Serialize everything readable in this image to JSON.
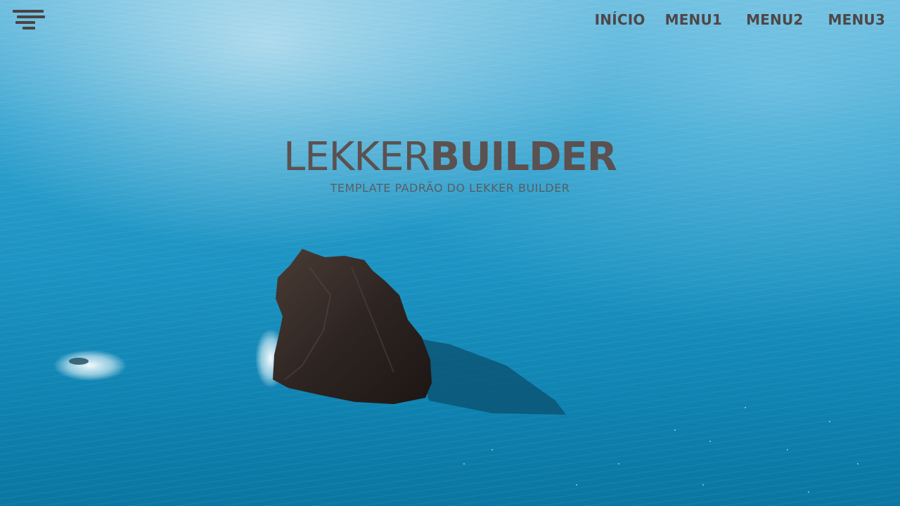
{
  "header": {
    "menu_icon": "hamburger-menu-icon",
    "nav": [
      {
        "label": "INÍCIO"
      },
      {
        "label": "MENU1"
      },
      {
        "label": "MENU2"
      },
      {
        "label": "MENU3"
      }
    ]
  },
  "hero": {
    "brand_light": "LEKKER",
    "brand_bold": "BUILDER",
    "subtitle": "TEMPLATE PADRÃO DO LEKKER BUILDER"
  },
  "colors": {
    "text": "#5b5150",
    "ocean": "#1b93c2",
    "rock": "#2e2522"
  }
}
